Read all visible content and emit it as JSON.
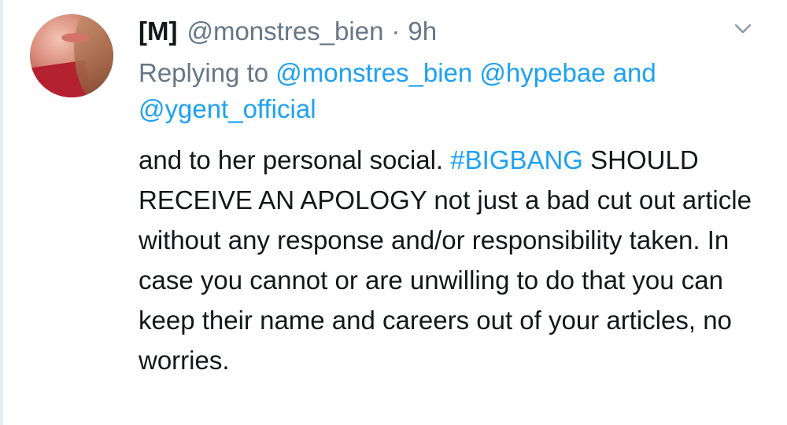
{
  "tweet": {
    "display_name": "[M]",
    "handle": "@monstres_bien",
    "separator": "·",
    "time": "9h",
    "avatar_icon": "user-avatar",
    "menu_icon": "chevron-down-icon",
    "reply": {
      "prefix": "Replying to",
      "mention_1": "@monstres_bien",
      "mention_2": "@hypebae",
      "conjunction": "and",
      "mention_3": "@ygent_official"
    },
    "body": {
      "part_1": "and to her personal social.",
      "hashtag": "#BIGBANG",
      "part_2": "SHOULD RECEIVE AN APOLOGY not just a bad cut out article without any response and/or responsibility taken. In case you cannot or are unwilling to do that you can keep their name and careers out of your articles, no worries."
    }
  },
  "colors": {
    "text": "#14171a",
    "muted": "#657786",
    "link": "#1da1f2"
  }
}
